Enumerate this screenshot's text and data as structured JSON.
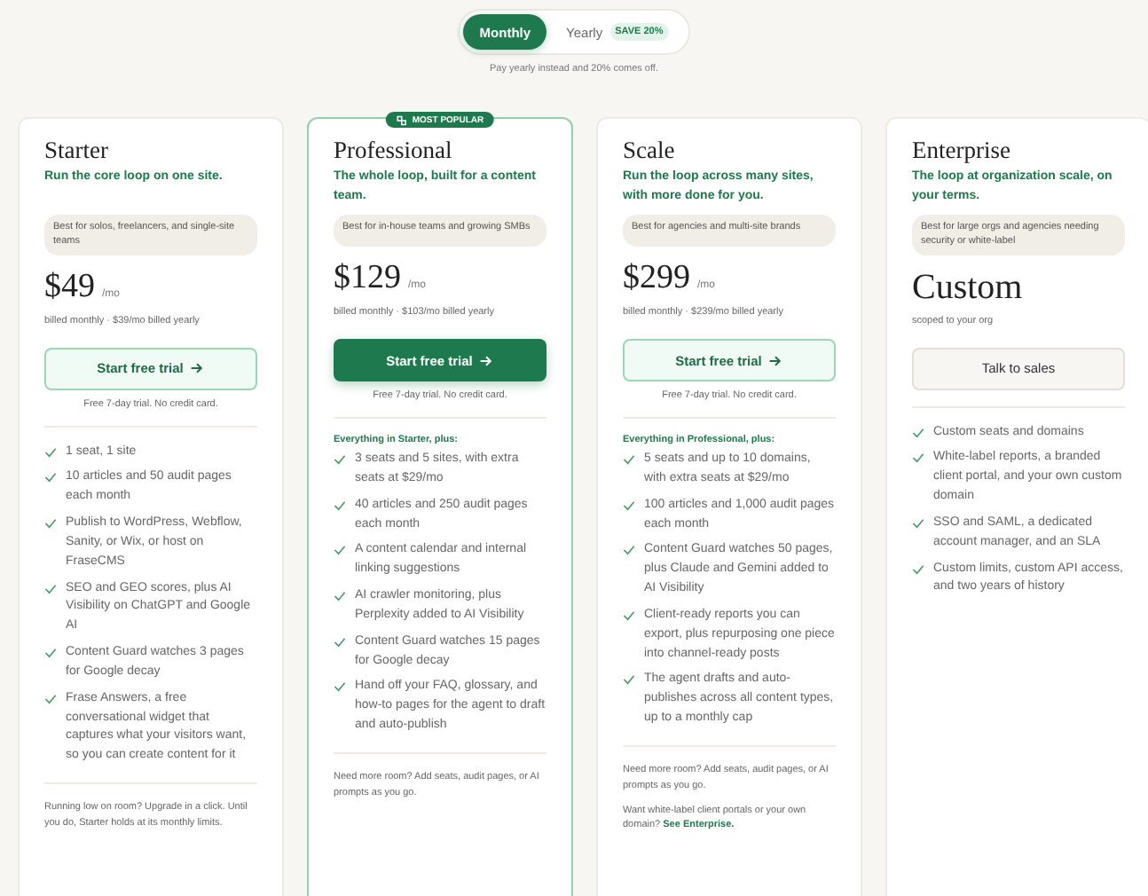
{
  "billing_toggle": {
    "options": [
      {
        "label": "Monthly",
        "selected": true
      },
      {
        "label": "Yearly",
        "selected": false,
        "badge": "SAVE 20%"
      }
    ],
    "note": "Pay yearly instead and 20% comes off."
  },
  "plans": [
    {
      "name": "Starter",
      "featured": false,
      "tagline": "Run the core loop on one site.",
      "audience": "Best for solos, freelancers, and single-site teams",
      "price": "$49",
      "period": "/mo",
      "billing": "billed monthly · $39/mo billed yearly",
      "cta": {
        "label": "Start free trial",
        "kind": "outline",
        "arrow": true
      },
      "cta_note": "Free 7-day trial. No credit card.",
      "features": [
        "1 seat, 1 site",
        "10 articles and 50 audit pages each month",
        "Publish to WordPress, Webflow, Sanity, or Wix, or host on FraseCMS",
        "SEO and GEO scores, plus AI Visibility on ChatGPT and Google AI",
        "Content Guard watches 3 pages for Google decay",
        "Frase Answers, a free conversational widget that captures what your visitors want, so you can create content for it"
      ],
      "notes": [
        {
          "text": "Running low on room? Upgrade in a click. Until you do, Starter holds at its monthly limits."
        }
      ]
    },
    {
      "name": "Professional",
      "featured": true,
      "ribbon": "MOST POPULAR",
      "tagline": "The whole loop, built for a content team.",
      "audience": "Best for in-house teams and growing SMBs",
      "price": "$129",
      "period": "/mo",
      "billing": "billed monthly · $103/mo billed yearly",
      "cta": {
        "label": "Start free trial",
        "kind": "primary",
        "arrow": true
      },
      "cta_note": "Free 7-day trial. No credit card.",
      "features_heading": "Everything in Starter, plus:",
      "features": [
        "3 seats and 5 sites, with extra seats at $29/mo",
        "40 articles and 250 audit pages each month",
        "A content calendar and internal linking suggestions",
        "AI crawler monitoring, plus Perplexity added to AI Visibility",
        "Content Guard watches 15 pages for Google decay",
        "Hand off your FAQ, glossary, and how-to pages for the agent to draft and auto-publish"
      ],
      "notes": [
        {
          "text": "Need more room? Add seats, audit pages, or AI prompts as you go."
        }
      ]
    },
    {
      "name": "Scale",
      "featured": false,
      "tagline": "Run the loop across many sites, with more done for you.",
      "audience": "Best for agencies and multi-site brands",
      "price": "$299",
      "period": "/mo",
      "billing": "billed monthly · $239/mo billed yearly",
      "cta": {
        "label": "Start free trial",
        "kind": "outline",
        "arrow": true
      },
      "cta_note": "Free 7-day trial. No credit card.",
      "features_heading": "Everything in Professional, plus:",
      "features": [
        "5 seats and up to 10 domains, with extra seats at $29/mo",
        "100 articles and 1,000 audit pages each month",
        "Content Guard watches 50 pages, plus Claude and Gemini added to AI Visibility",
        "Client-ready reports you can export, plus repurposing one piece into channel-ready posts",
        "The agent drafts and auto-publishes across all content types, up to a monthly cap"
      ],
      "notes": [
        {
          "text": "Need more room? Add seats, audit pages, or AI prompts as you go."
        },
        {
          "text": "Want white-label client portals or your own domain?",
          "link": "See Enterprise."
        }
      ]
    },
    {
      "name": "Enterprise",
      "featured": false,
      "tagline": "The loop at organization scale, on your terms.",
      "audience": "Best for large orgs and agencies needing security or white-label",
      "price": "Custom",
      "billing": "scoped to your org",
      "cta": {
        "label": "Talk to sales",
        "kind": "neutral",
        "arrow": false
      },
      "features": [
        "Custom seats and domains",
        "White-label reports, a branded client portal, and your own custom domain",
        "SSO and SAML, a dedicated account manager, and an SLA",
        "Custom limits, custom API access, and two years of history"
      ]
    }
  ]
}
